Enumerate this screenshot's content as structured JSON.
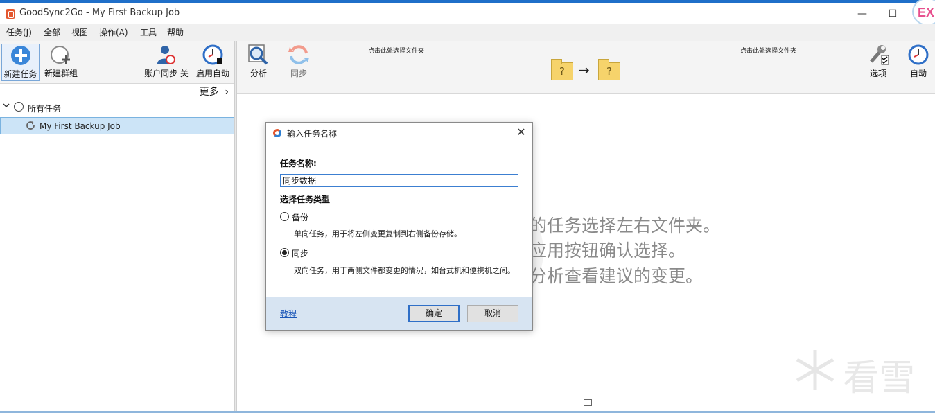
{
  "window": {
    "title": "GoodSync2Go - My First Backup Job",
    "minimize": "—",
    "maximize": "☐",
    "badge": "EX"
  },
  "menu": [
    "任务(J)",
    "全部",
    "视图",
    "操作(A)",
    "工具",
    "帮助"
  ],
  "left_toolbar": {
    "new_job": "新建任务",
    "new_group": "新建群组",
    "account_sync": "账户同步 关",
    "auto_start": "启用自动"
  },
  "sidebar": {
    "more": "更多",
    "more_chevron": "›",
    "tree_root": "所有任务",
    "job": "My First Backup Job"
  },
  "right_toolbar": {
    "analyze": "分析",
    "sync": "同步",
    "left_folder_hint": "点击此处选择文件夹",
    "right_folder_hint": "点击此处选择文件夹",
    "folder_placeholder": "?",
    "arrow": "→",
    "options": "选项",
    "auto": "自动"
  },
  "hints": [
    "的任务选择左右文件夹。",
    "应用按钮确认选择。",
    "分析查看建议的变更。"
  ],
  "watermark": "看雪",
  "dialog": {
    "title": "输入任务名称",
    "close": "✕",
    "name_label": "任务名称:",
    "name_value": "同步数据",
    "type_label": "选择任务类型",
    "options": [
      {
        "label": "备份",
        "desc": "单向任务，用于将左侧变更复制到右侧备份存储。",
        "checked": false
      },
      {
        "label": "同步",
        "desc": "双向任务，用于两侧文件都变更的情况，如台式机和便携机之间。",
        "checked": true
      }
    ],
    "tutorial": "教程",
    "ok": "确定",
    "cancel": "取消"
  },
  "colors": {
    "accent": "#1f6fc9",
    "selection": "#cce4f7",
    "folder": "#f6d36b",
    "dialog_footer": "#d7e4f2"
  }
}
